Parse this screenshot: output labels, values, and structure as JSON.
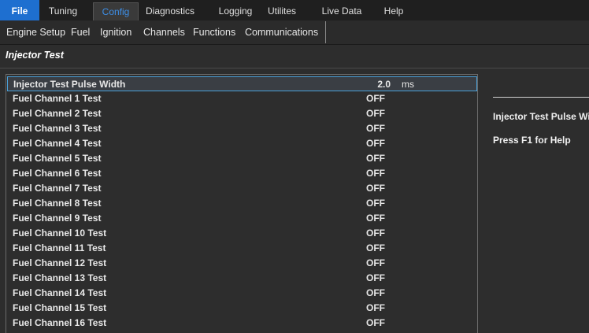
{
  "menu": {
    "tabs": [
      {
        "label": "File"
      },
      {
        "label": "Tuning"
      },
      {
        "label": "Config"
      },
      {
        "label": "Diagnostics"
      },
      {
        "label": "Logging"
      },
      {
        "label": "Utilites"
      },
      {
        "label": "Live Data"
      },
      {
        "label": "Help"
      }
    ],
    "active_tab": "Config"
  },
  "submenu": {
    "items": [
      {
        "label": "Engine Setup"
      },
      {
        "label": "Fuel"
      },
      {
        "label": "Ignition"
      },
      {
        "label": "Channels"
      },
      {
        "label": "Functions"
      },
      {
        "label": "Communications"
      }
    ]
  },
  "panel": {
    "title": "Injector Test"
  },
  "params": [
    {
      "name": "Injector Test Pulse Width",
      "value": "2.0",
      "unit": "ms"
    },
    {
      "name": "Fuel Channel 1 Test",
      "value": "OFF"
    },
    {
      "name": "Fuel Channel 2 Test",
      "value": "OFF"
    },
    {
      "name": "Fuel Channel 3 Test",
      "value": "OFF"
    },
    {
      "name": "Fuel Channel 4 Test",
      "value": "OFF"
    },
    {
      "name": "Fuel Channel 5 Test",
      "value": "OFF"
    },
    {
      "name": "Fuel Channel 6 Test",
      "value": "OFF"
    },
    {
      "name": "Fuel Channel 7 Test",
      "value": "OFF"
    },
    {
      "name": "Fuel Channel 8 Test",
      "value": "OFF"
    },
    {
      "name": "Fuel Channel 9 Test",
      "value": "OFF"
    },
    {
      "name": "Fuel Channel 10 Test",
      "value": "OFF"
    },
    {
      "name": "Fuel Channel 11 Test",
      "value": "OFF"
    },
    {
      "name": "Fuel Channel 12 Test",
      "value": "OFF"
    },
    {
      "name": "Fuel Channel 13 Test",
      "value": "OFF"
    },
    {
      "name": "Fuel Channel 14 Test",
      "value": "OFF"
    },
    {
      "name": "Fuel Channel 15 Test",
      "value": "OFF"
    },
    {
      "name": "Fuel Channel 16 Test",
      "value": "OFF"
    }
  ],
  "help": {
    "title": "Injector Test Pulse Width",
    "hint": "Press F1 for Help"
  },
  "colors": {
    "accent": "#1e6fd0",
    "active_tab_text": "#3d8fe8",
    "selection_border": "#4aa0d8"
  }
}
